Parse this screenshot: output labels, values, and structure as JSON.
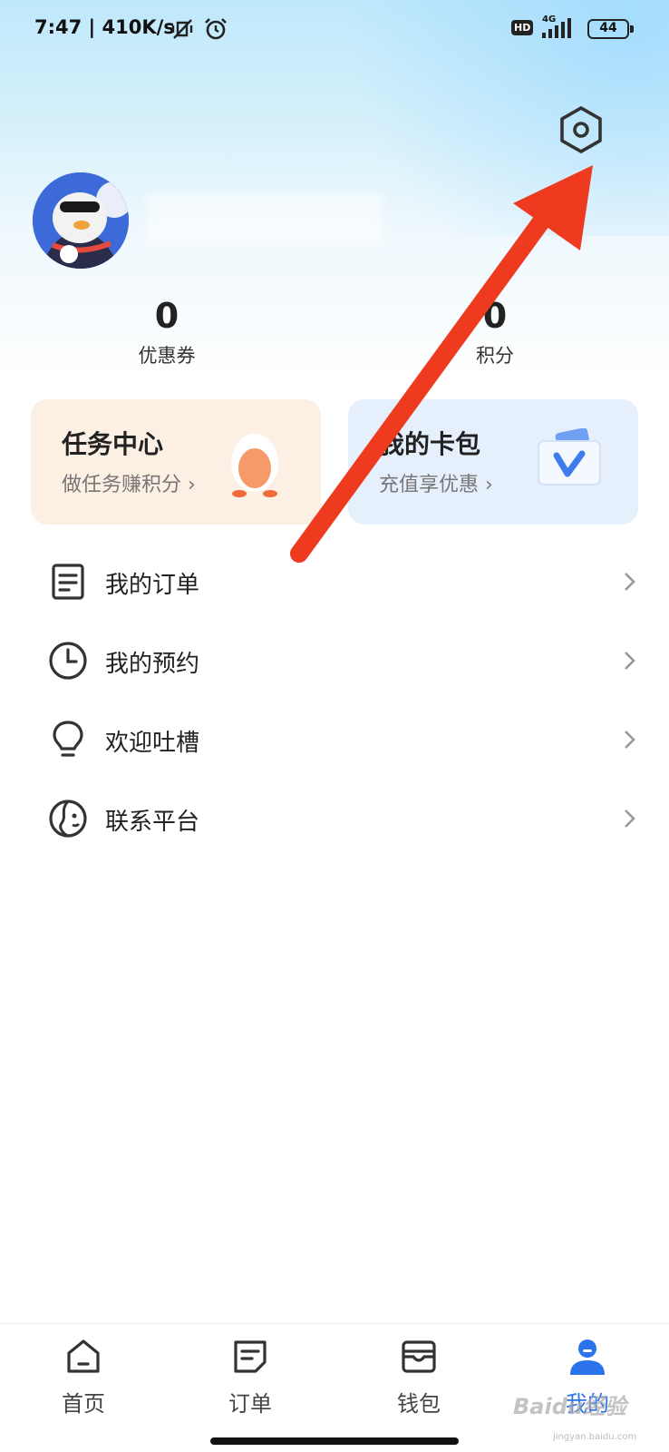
{
  "status_bar": {
    "time_speed": "7:47 | 410K/s",
    "hd": "HD",
    "network": "4G",
    "battery": "44"
  },
  "header": {
    "settings_icon": "settings-hexagon-icon"
  },
  "stats": {
    "coupons_value": "0",
    "coupons_label": "优惠券",
    "points_value": "0",
    "points_label": "积分"
  },
  "cards": {
    "task": {
      "title": "任务中心",
      "subtitle": "做任务赚积分 ›"
    },
    "wallet": {
      "title": "我的卡包",
      "subtitle": "充值享优惠 ›"
    }
  },
  "menu": [
    {
      "label": "我的订单",
      "icon": "order-list-icon"
    },
    {
      "label": "我的预约",
      "icon": "clock-icon"
    },
    {
      "label": "欢迎吐槽",
      "icon": "lightbulb-icon"
    },
    {
      "label": "联系平台",
      "icon": "contact-face-icon"
    }
  ],
  "tabs": [
    {
      "label": "首页",
      "icon": "home-icon"
    },
    {
      "label": "订单",
      "icon": "orders-icon"
    },
    {
      "label": "钱包",
      "icon": "wallet-icon"
    },
    {
      "label": "我的",
      "icon": "user-icon",
      "active": true
    }
  ],
  "colors": {
    "accent": "#2a73ea",
    "annotation_arrow": "#ee3a1f"
  },
  "watermark": {
    "brand": "Baidu经验",
    "url": "jingyan.baidu.com"
  }
}
